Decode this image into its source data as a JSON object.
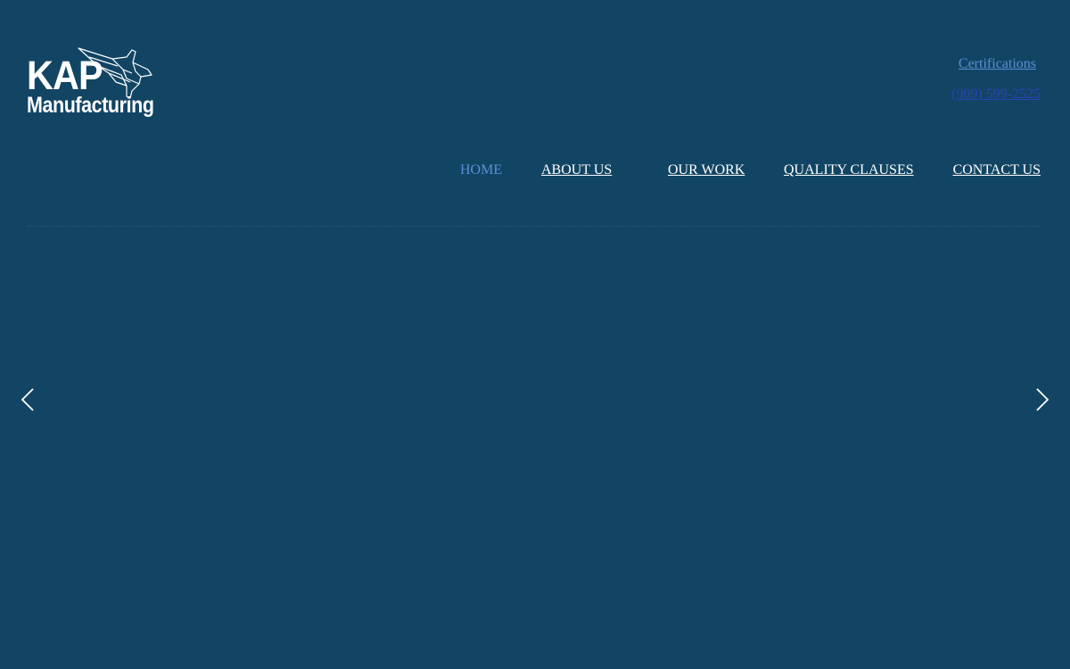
{
  "brand": {
    "line1": "KAP",
    "line2": "Manufacturing",
    "icon": "jet-icon"
  },
  "header": {
    "certifications_link": "Certifications",
    "phone_link": "(909) 599-2525"
  },
  "nav": {
    "items": [
      {
        "label": "HOME",
        "active": true
      },
      {
        "label": "ABOUT US",
        "active": false
      },
      {
        "label": "OUR WORK",
        "active": false
      },
      {
        "label": "QUALITY CLAUSES",
        "active": false
      },
      {
        "label": "CONTACT US",
        "active": false
      }
    ]
  },
  "slider": {
    "prev_icon": "chevron-left-icon",
    "next_icon": "chevron-right-icon"
  },
  "colors": {
    "background": "#124564",
    "active_link": "#5b8fd6",
    "phone_link": "#2a43b8",
    "text": "#ffffff"
  }
}
